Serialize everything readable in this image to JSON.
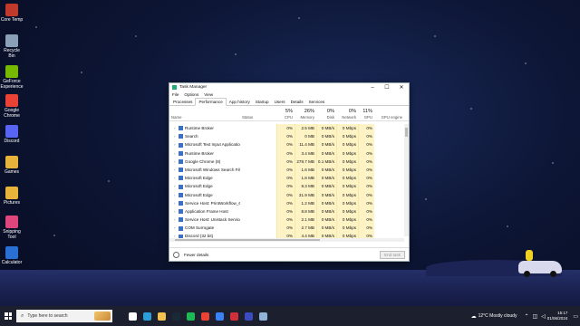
{
  "desktop": {
    "icons": [
      {
        "label": "Core Temp",
        "icon": "thermometer-icon",
        "color": "#c0392b"
      },
      {
        "label": "Recycle Bin",
        "icon": "recycle-bin-icon",
        "color": "#8aa0b8"
      },
      {
        "label": "GeForce Experience",
        "icon": "geforce-icon",
        "color": "#76b900"
      },
      {
        "label": "Google Chrome",
        "icon": "chrome-icon",
        "color": "#ea4335"
      },
      {
        "label": "Discord",
        "icon": "discord-icon",
        "color": "#5865f2"
      },
      {
        "label": "Games",
        "icon": "folder-icon",
        "color": "#e8b33b"
      },
      {
        "label": "Pictures",
        "icon": "folder-icon",
        "color": "#e8b33b"
      },
      {
        "label": "Snipping Tool",
        "icon": "snipping-tool-icon",
        "color": "#e0457b"
      },
      {
        "label": "Calculator",
        "icon": "calculator-icon",
        "color": "#2a6fd4"
      }
    ]
  },
  "task_manager": {
    "title": "Task Manager",
    "window_controls": {
      "minimize": "–",
      "maximize": "☐",
      "close": "✕"
    },
    "menu": [
      "File",
      "Options",
      "View"
    ],
    "tabs": [
      "Processes",
      "Performance",
      "App history",
      "Startup",
      "Users",
      "Details",
      "Services"
    ],
    "active_tab": "Performance",
    "columns": [
      {
        "label": "Name",
        "pct": ""
      },
      {
        "label": "Status",
        "pct": ""
      },
      {
        "label": "CPU",
        "pct": "5%"
      },
      {
        "label": "Memory",
        "pct": "26%"
      },
      {
        "label": "Disk",
        "pct": "0%"
      },
      {
        "label": "Network",
        "pct": "0%"
      },
      {
        "label": "GPU",
        "pct": "11%"
      },
      {
        "label": "GPU engine",
        "pct": ""
      }
    ],
    "rows": [
      {
        "name": "Runtime Broker",
        "status": "",
        "cpu": "0%",
        "memory": "2.5 MB",
        "disk": "0 MB/s",
        "network": "0 Mbps",
        "gpu": "0%"
      },
      {
        "name": "Search",
        "status": "",
        "cpu": "0%",
        "memory": "0 MB",
        "disk": "0 MB/s",
        "network": "0 Mbps",
        "gpu": "0%"
      },
      {
        "name": "Microsoft Text Input Application",
        "status": "",
        "cpu": "0%",
        "memory": "11.4 MB",
        "disk": "0 MB/s",
        "network": "0 Mbps",
        "gpu": "0%"
      },
      {
        "name": "Runtime Broker",
        "status": "",
        "cpu": "0%",
        "memory": "3.4 MB",
        "disk": "0 MB/s",
        "network": "0 Mbps",
        "gpu": "0%"
      },
      {
        "name": "Google Chrome (8)",
        "status": "",
        "cpu": "0%",
        "memory": "278.7 MB",
        "disk": "0.1 MB/s",
        "network": "0 Mbps",
        "gpu": "0%"
      },
      {
        "name": "Microsoft Windows Search Filte...",
        "status": "",
        "cpu": "0%",
        "memory": "1.6 MB",
        "disk": "0 MB/s",
        "network": "0 Mbps",
        "gpu": "0%"
      },
      {
        "name": "Microsoft Edge",
        "status": "",
        "cpu": "0%",
        "memory": "1.8 MB",
        "disk": "0 MB/s",
        "network": "0 Mbps",
        "gpu": "0%"
      },
      {
        "name": "Microsoft Edge",
        "status": "",
        "cpu": "0%",
        "memory": "8.3 MB",
        "disk": "0 MB/s",
        "network": "0 Mbps",
        "gpu": "0%"
      },
      {
        "name": "Microsoft Edge",
        "status": "",
        "cpu": "0%",
        "memory": "31.9 MB",
        "disk": "0 MB/s",
        "network": "0 Mbps",
        "gpu": "0%"
      },
      {
        "name": "Service Host: PrintWorkflow_6b...",
        "status": "",
        "cpu": "0%",
        "memory": "1.2 MB",
        "disk": "0 MB/s",
        "network": "0 Mbps",
        "gpu": "0%"
      },
      {
        "name": "Application Frame Host",
        "status": "",
        "cpu": "0%",
        "memory": "8.8 MB",
        "disk": "0 MB/s",
        "network": "0 Mbps",
        "gpu": "0%"
      },
      {
        "name": "Service Host: Unistack Service G...",
        "status": "",
        "cpu": "0%",
        "memory": "2.1 MB",
        "disk": "0 MB/s",
        "network": "0 Mbps",
        "gpu": "0%"
      },
      {
        "name": "COM Surrogate",
        "status": "",
        "cpu": "0%",
        "memory": "2.7 MB",
        "disk": "0 MB/s",
        "network": "0 Mbps",
        "gpu": "0%"
      },
      {
        "name": "Discord (32 bit)",
        "status": "",
        "cpu": "0%",
        "memory": "4.4 MB",
        "disk": "0 MB/s",
        "network": "0 Mbps",
        "gpu": "0%"
      }
    ],
    "footer": {
      "fewer_details": "Fewer details",
      "end_task": "End task"
    }
  },
  "taskbar": {
    "search_placeholder": "Type here to search",
    "apps": [
      {
        "icon": "task-view-icon",
        "color": "#ffffff"
      },
      {
        "icon": "edge-icon",
        "color": "#2b9fd9"
      },
      {
        "icon": "file-explorer-icon",
        "color": "#f2c14e"
      },
      {
        "icon": "steam-icon",
        "color": "#1b2838"
      },
      {
        "icon": "spotify-icon",
        "color": "#1db954"
      },
      {
        "icon": "chrome-icon",
        "color": "#ea4335"
      },
      {
        "icon": "mail-icon",
        "color": "#3b82f6"
      },
      {
        "icon": "app-icon",
        "color": "#d1303b"
      },
      {
        "icon": "app-icon",
        "color": "#3b4cc0"
      },
      {
        "icon": "task-manager-icon",
        "color": "#8fb3d9"
      }
    ],
    "weather": "12°C  Mostly cloudy",
    "time": "15:17",
    "date": "01/06/2024"
  }
}
